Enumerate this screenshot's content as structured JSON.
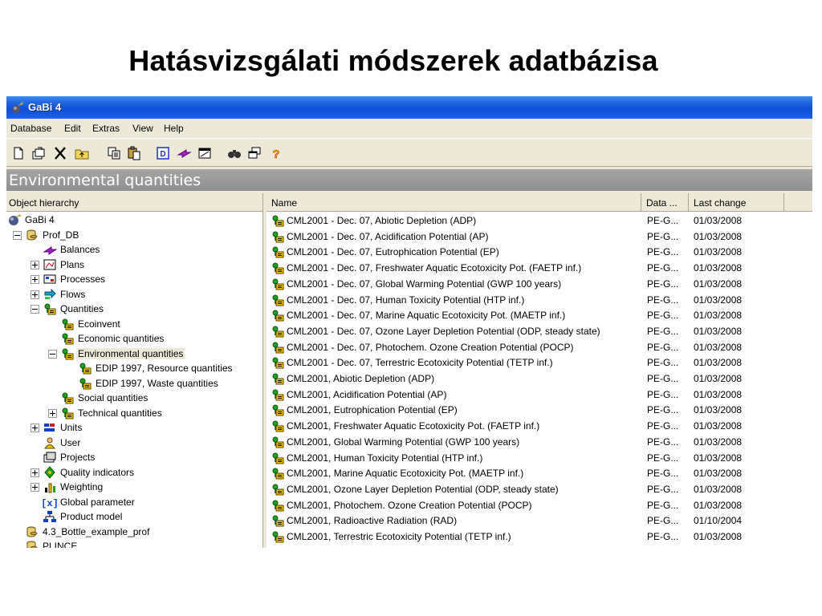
{
  "slide_title": "Hatásvizsgálati módszerek adatbázisa",
  "window": {
    "title": "GaBi 4"
  },
  "menu": [
    "Database",
    "Edit",
    "Extras",
    "View",
    "Help"
  ],
  "toolbar_icons": [
    "new-icon",
    "open-icon",
    "delete-icon",
    "folder-up-icon",
    "copy-icon",
    "paste-icon",
    "database-icon",
    "transfer-icon",
    "window-icon",
    "find-icon",
    "cascade-icon",
    "help-icon"
  ],
  "section_header": "Environmental quantities",
  "tree": {
    "header": "Object hierarchy",
    "items": [
      {
        "label": "GaBi 4",
        "level": 0,
        "icon": "globe-icon",
        "expander": "none"
      },
      {
        "label": "Prof_DB",
        "level": 1,
        "icon": "database-icon",
        "expander": "minus"
      },
      {
        "label": "Balances",
        "level": 2,
        "icon": "balance-icon",
        "expander": "none"
      },
      {
        "label": "Plans",
        "level": 2,
        "icon": "plan-icon",
        "expander": "plus"
      },
      {
        "label": "Processes",
        "level": 2,
        "icon": "process-icon",
        "expander": "plus"
      },
      {
        "label": "Flows",
        "level": 2,
        "icon": "flow-icon",
        "expander": "plus"
      },
      {
        "label": "Quantities",
        "level": 2,
        "icon": "quantity-icon",
        "expander": "minus"
      },
      {
        "label": "Ecoinvent",
        "level": 3,
        "icon": "quantity-icon",
        "expander": "none"
      },
      {
        "label": "Economic quantities",
        "level": 3,
        "icon": "quantity-icon",
        "expander": "none"
      },
      {
        "label": "Environmental quantities",
        "level": 3,
        "icon": "quantity-icon",
        "expander": "minus",
        "selected": true
      },
      {
        "label": "EDIP 1997, Resource quantities",
        "level": 4,
        "icon": "quantity-icon",
        "expander": "none"
      },
      {
        "label": "EDIP 1997, Waste quantities",
        "level": 4,
        "icon": "quantity-icon",
        "expander": "none"
      },
      {
        "label": "Social quantities",
        "level": 3,
        "icon": "quantity-icon",
        "expander": "none"
      },
      {
        "label": "Technical quantities",
        "level": 3,
        "icon": "quantity-icon",
        "expander": "plus"
      },
      {
        "label": "Units",
        "level": 2,
        "icon": "units-icon",
        "expander": "plus"
      },
      {
        "label": "User",
        "level": 2,
        "icon": "user-icon",
        "expander": "none"
      },
      {
        "label": "Projects",
        "level": 2,
        "icon": "projects-icon",
        "expander": "none"
      },
      {
        "label": "Quality indicators",
        "level": 2,
        "icon": "quality-icon",
        "expander": "plus"
      },
      {
        "label": "Weighting",
        "level": 2,
        "icon": "weighting-icon",
        "expander": "plus"
      },
      {
        "label": "Global parameter",
        "level": 2,
        "icon": "parameter-icon",
        "expander": "none"
      },
      {
        "label": "Product model",
        "level": 2,
        "icon": "model-icon",
        "expander": "none"
      },
      {
        "label": "4.3_Bottle_example_prof",
        "level": 1,
        "icon": "database-icon",
        "expander": "none"
      },
      {
        "label": "PLINCE",
        "level": 1,
        "icon": "database-icon",
        "expander": "none"
      }
    ]
  },
  "list": {
    "columns": [
      "Name",
      "Data ...",
      "Last change"
    ],
    "rows": [
      {
        "name": "CML2001 - Dec. 07, Abiotic Depletion (ADP)",
        "data": "PE-G...",
        "date": "01/03/2008"
      },
      {
        "name": "CML2001 - Dec. 07, Acidification Potential (AP)",
        "data": "PE-G...",
        "date": "01/03/2008"
      },
      {
        "name": "CML2001 - Dec. 07, Eutrophication Potential (EP)",
        "data": "PE-G...",
        "date": "01/03/2008"
      },
      {
        "name": "CML2001 - Dec. 07, Freshwater Aquatic Ecotoxicity Pot. (FAETP inf.)",
        "data": "PE-G...",
        "date": "01/03/2008"
      },
      {
        "name": "CML2001 - Dec. 07, Global Warming Potential (GWP 100 years)",
        "data": "PE-G...",
        "date": "01/03/2008"
      },
      {
        "name": "CML2001 - Dec. 07, Human Toxicity Potential (HTP inf.)",
        "data": "PE-G...",
        "date": "01/03/2008"
      },
      {
        "name": "CML2001 - Dec. 07, Marine Aquatic Ecotoxicity Pot. (MAETP inf.)",
        "data": "PE-G...",
        "date": "01/03/2008"
      },
      {
        "name": "CML2001 - Dec. 07, Ozone Layer Depletion Potential (ODP, steady state)",
        "data": "PE-G...",
        "date": "01/03/2008"
      },
      {
        "name": "CML2001 - Dec. 07, Photochem. Ozone Creation Potential (POCP)",
        "data": "PE-G...",
        "date": "01/03/2008"
      },
      {
        "name": "CML2001 - Dec. 07, Terrestric Ecotoxicity Potential (TETP inf.)",
        "data": "PE-G...",
        "date": "01/03/2008"
      },
      {
        "name": "CML2001, Abiotic Depletion (ADP)",
        "data": "PE-G...",
        "date": "01/03/2008"
      },
      {
        "name": "CML2001, Acidification Potential (AP)",
        "data": "PE-G...",
        "date": "01/03/2008"
      },
      {
        "name": "CML2001, Eutrophication Potential (EP)",
        "data": "PE-G...",
        "date": "01/03/2008"
      },
      {
        "name": "CML2001, Freshwater Aquatic Ecotoxicity Pot. (FAETP inf.)",
        "data": "PE-G...",
        "date": "01/03/2008"
      },
      {
        "name": "CML2001, Global Warming Potential (GWP 100 years)",
        "data": "PE-G...",
        "date": "01/03/2008"
      },
      {
        "name": "CML2001, Human Toxicity Potential (HTP inf.)",
        "data": "PE-G...",
        "date": "01/03/2008"
      },
      {
        "name": "CML2001, Marine Aquatic Ecotoxicity Pot. (MAETP inf.)",
        "data": "PE-G...",
        "date": "01/03/2008"
      },
      {
        "name": "CML2001, Ozone Layer Depletion Potential (ODP, steady state)",
        "data": "PE-G...",
        "date": "01/03/2008"
      },
      {
        "name": "CML2001, Photochem. Ozone Creation Potential (POCP)",
        "data": "PE-G...",
        "date": "01/03/2008"
      },
      {
        "name": "CML2001, Radioactive Radiation (RAD)",
        "data": "PE-G...",
        "date": "01/10/2004"
      },
      {
        "name": "CML2001, Terrestric Ecotoxicity Potential (TETP inf.)",
        "data": "PE-G...",
        "date": "01/03/2008"
      }
    ]
  }
}
